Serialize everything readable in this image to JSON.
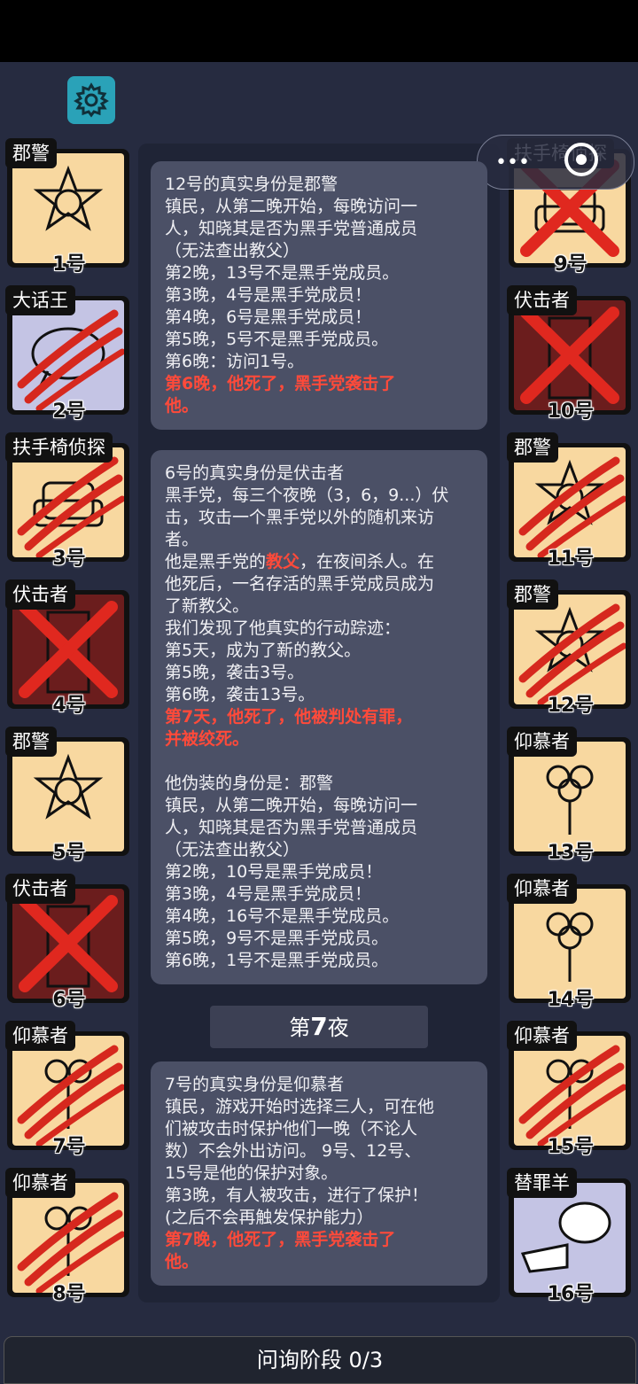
{
  "bottom_bar": {
    "label": "问询阶段 0/3"
  },
  "night_marker": {
    "prefix": "第",
    "number": "7",
    "suffix": "夜"
  },
  "players_left": [
    {
      "role": "郡警",
      "num": "1号"
    },
    {
      "role": "大话王",
      "num": "2号"
    },
    {
      "role": "扶手椅侦探",
      "num": "3号"
    },
    {
      "role": "伏击者",
      "num": "4号"
    },
    {
      "role": "郡警",
      "num": "5号"
    },
    {
      "role": "伏击者",
      "num": "6号"
    },
    {
      "role": "仰慕者",
      "num": "7号"
    },
    {
      "role": "仰慕者",
      "num": "8号"
    }
  ],
  "players_right": [
    {
      "role": "扶手椅侦探",
      "num": "9号"
    },
    {
      "role": "伏击者",
      "num": "10号"
    },
    {
      "role": "郡警",
      "num": "11号"
    },
    {
      "role": "郡警",
      "num": "12号"
    },
    {
      "role": "仰慕者",
      "num": "13号"
    },
    {
      "role": "仰慕者",
      "num": "14号"
    },
    {
      "role": "仰慕者",
      "num": "15号"
    },
    {
      "role": "替罪羊",
      "num": "16号"
    }
  ],
  "bubble1": {
    "lines": [
      "12号的真实身份是郡警",
      "镇民，从第二晚开始，每晚访问一",
      "人，知晓其是否为黑手党普通成员",
      "（无法查出教父）",
      "第2晚，13号不是黑手党成员。",
      "第3晚，4号是黑手党成员！",
      "第4晚，6号是黑手党成员！",
      "第5晚，5号不是黑手党成员。",
      "第6晚：访问1号。"
    ],
    "death_1": "第6晚，他死了，黑手党袭击了",
    "death_2": "他。"
  },
  "bubble2": {
    "l1": "6号的真实身份是伏击者",
    "l2": "黑手党，每三个夜晚（3，6，9...）伏",
    "l3": "击，攻击一个黑手党以外的随机来访",
    "l4": "者。",
    "l5a": "他是黑手党的",
    "l5b": "教父",
    "l5c": "，在夜间杀人。在",
    "l6": "他死后，一名存活的黑手党成员成为",
    "l7": "了新教父。",
    "l8": "我们发现了他真实的行动踪迹：",
    "l9": "第5天，成为了新的教父。",
    "l10": "第5晚，袭击3号。",
    "l11": "第6晚，袭击13号。",
    "death_1": "第7天，他死了，他被判处有罪，",
    "death_2": "并被绞死。",
    "l12": "他伪装的身份是：郡警",
    "l13": "镇民，从第二晚开始，每晚访问一",
    "l14": "人，知晓其是否为黑手党普通成员",
    "l15": "（无法查出教父）",
    "l16": "第2晚，10号是黑手党成员！",
    "l17": "第3晚，4号是黑手党成员！",
    "l18": "第4晚，16号不是黑手党成员。",
    "l19": "第5晚，9号不是黑手党成员。",
    "l20": "第6晚，1号不是黑手党成员。"
  },
  "bubble3": {
    "lines": [
      "7号的真实身份是仰慕者",
      "镇民，游戏开始时选择三人，可在他",
      "们被攻击时保护他们一晚（不论人",
      "数）不会外出访问。 9号、12号、",
      "15号是他的保护对象。",
      "第3晚，有人被攻击，进行了保护！",
      "(之后不会再触发保护能力）"
    ],
    "death_1": "第7晚，他死了，黑手党袭击了",
    "death_2": "他。"
  }
}
